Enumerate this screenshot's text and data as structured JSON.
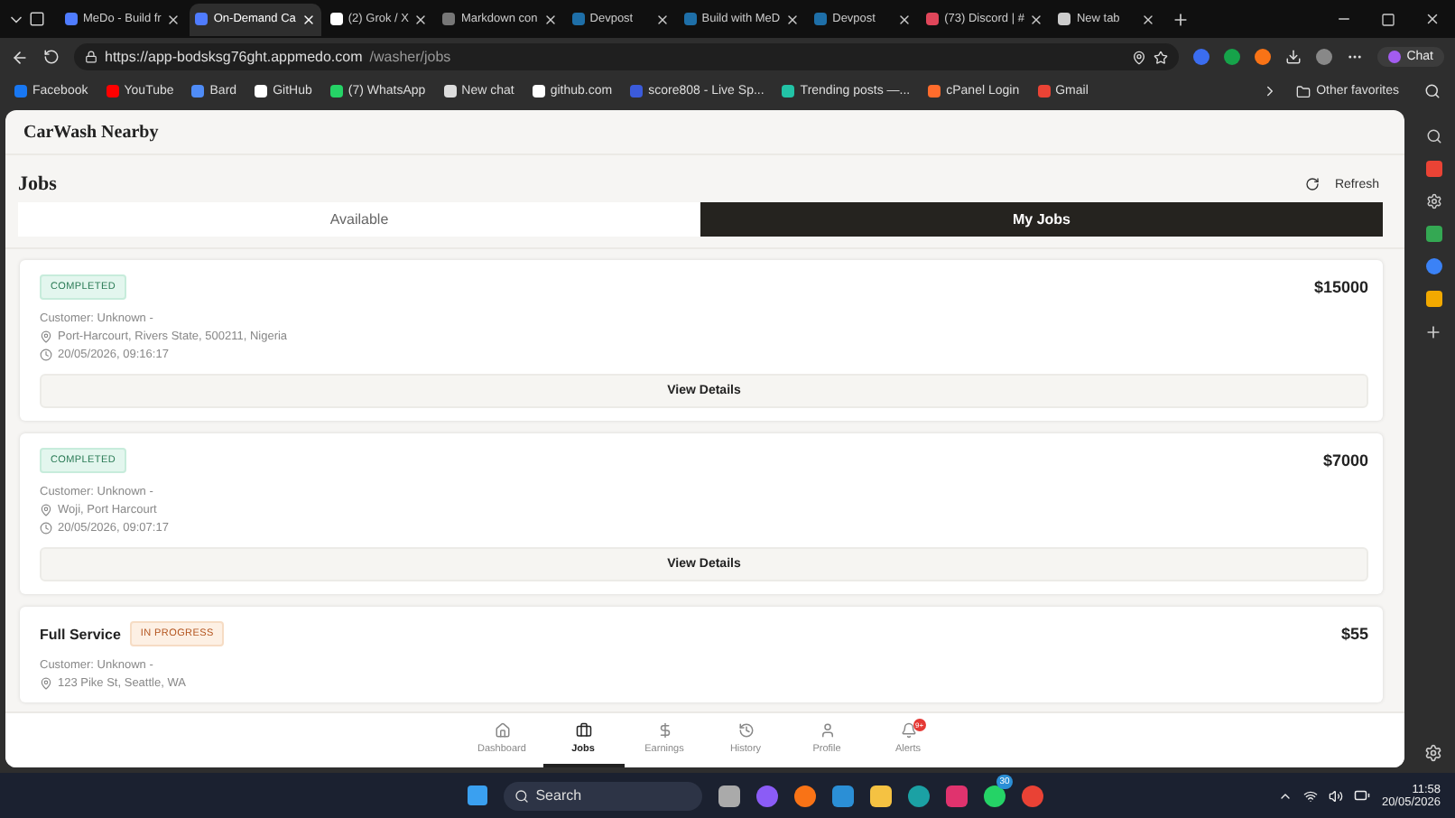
{
  "browser": {
    "tabs": [
      {
        "title": "MeDo - Build fr",
        "selected": false,
        "color": "#4f7cff"
      },
      {
        "title": "On-Demand Ca",
        "selected": true,
        "color": "#4f7cff"
      },
      {
        "title": "(2) Grok / X",
        "selected": false,
        "color": "#ffffff"
      },
      {
        "title": "Markdown con",
        "selected": false,
        "color": "#777777"
      },
      {
        "title": "Devpost",
        "selected": false,
        "color": "#1e6fa8"
      },
      {
        "title": "Build with MeD",
        "selected": false,
        "color": "#1e6fa8"
      },
      {
        "title": "Devpost",
        "selected": false,
        "color": "#1e6fa8"
      },
      {
        "title": "(73) Discord | #",
        "selected": false,
        "color": "#e0465a"
      },
      {
        "title": "New tab",
        "selected": false,
        "color": "#cccccc"
      }
    ],
    "url_host": "https://app-bodsksg76ght.appmedo.com",
    "url_path": "/washer/jobs",
    "chat_label": "Chat",
    "bookmarks": [
      {
        "label": "Facebook",
        "color": "#1877f2"
      },
      {
        "label": "YouTube",
        "color": "#ff0000"
      },
      {
        "label": "Bard",
        "color": "#4f8cf7"
      },
      {
        "label": "GitHub",
        "color": "#ffffff"
      },
      {
        "label": "(7) WhatsApp",
        "color": "#25d366"
      },
      {
        "label": "New chat",
        "color": "#dddddd"
      },
      {
        "label": "github.com",
        "color": "#ffffff"
      },
      {
        "label": "score808 - Live Sp...",
        "color": "#3b5bdb"
      },
      {
        "label": "Trending posts —...",
        "color": "#22c3a6"
      },
      {
        "label": "cPanel Login",
        "color": "#ff6c2c"
      },
      {
        "label": "Gmail",
        "color": "#ea4335"
      }
    ],
    "other_favorites": "Other favorites"
  },
  "app": {
    "brand": "CarWash Nearby",
    "heading": "Jobs",
    "refresh": "Refresh",
    "segments": [
      {
        "label": "Available",
        "selected": false
      },
      {
        "label": "My Jobs",
        "selected": true
      }
    ],
    "jobs": [
      {
        "status": "COMPLETED",
        "kind": "completed",
        "price": "$15000",
        "customer": "Customer: Unknown -",
        "address": "Port-Harcourt, Rivers State, 500211, Nigeria",
        "time": "20/05/2026, 09:16:17",
        "action": "View Details"
      },
      {
        "status": "COMPLETED",
        "kind": "completed",
        "price": "$7000",
        "customer": "Customer: Unknown -",
        "address": "Woji, Port Harcourt",
        "time": "20/05/2026, 09:07:17",
        "action": "View Details"
      },
      {
        "service": "Full Service",
        "status": "IN PROGRESS",
        "kind": "progress",
        "price": "$55",
        "customer": "Customer: Unknown -",
        "address": "123 Pike St, Seattle, WA"
      }
    ],
    "nav": [
      {
        "label": "Dashboard",
        "kind": "home",
        "selected": false
      },
      {
        "label": "Jobs",
        "kind": "briefcase",
        "selected": true
      },
      {
        "label": "Earnings",
        "kind": "dollar",
        "selected": false
      },
      {
        "label": "History",
        "kind": "history",
        "selected": false
      },
      {
        "label": "Profile",
        "kind": "user",
        "selected": false
      },
      {
        "label": "Alerts",
        "kind": "bell",
        "selected": false,
        "badge": "9+"
      }
    ]
  },
  "taskbar": {
    "search": "Search",
    "whatsapp_badge": "30",
    "time": "11:58",
    "date": "20/05/2026"
  }
}
